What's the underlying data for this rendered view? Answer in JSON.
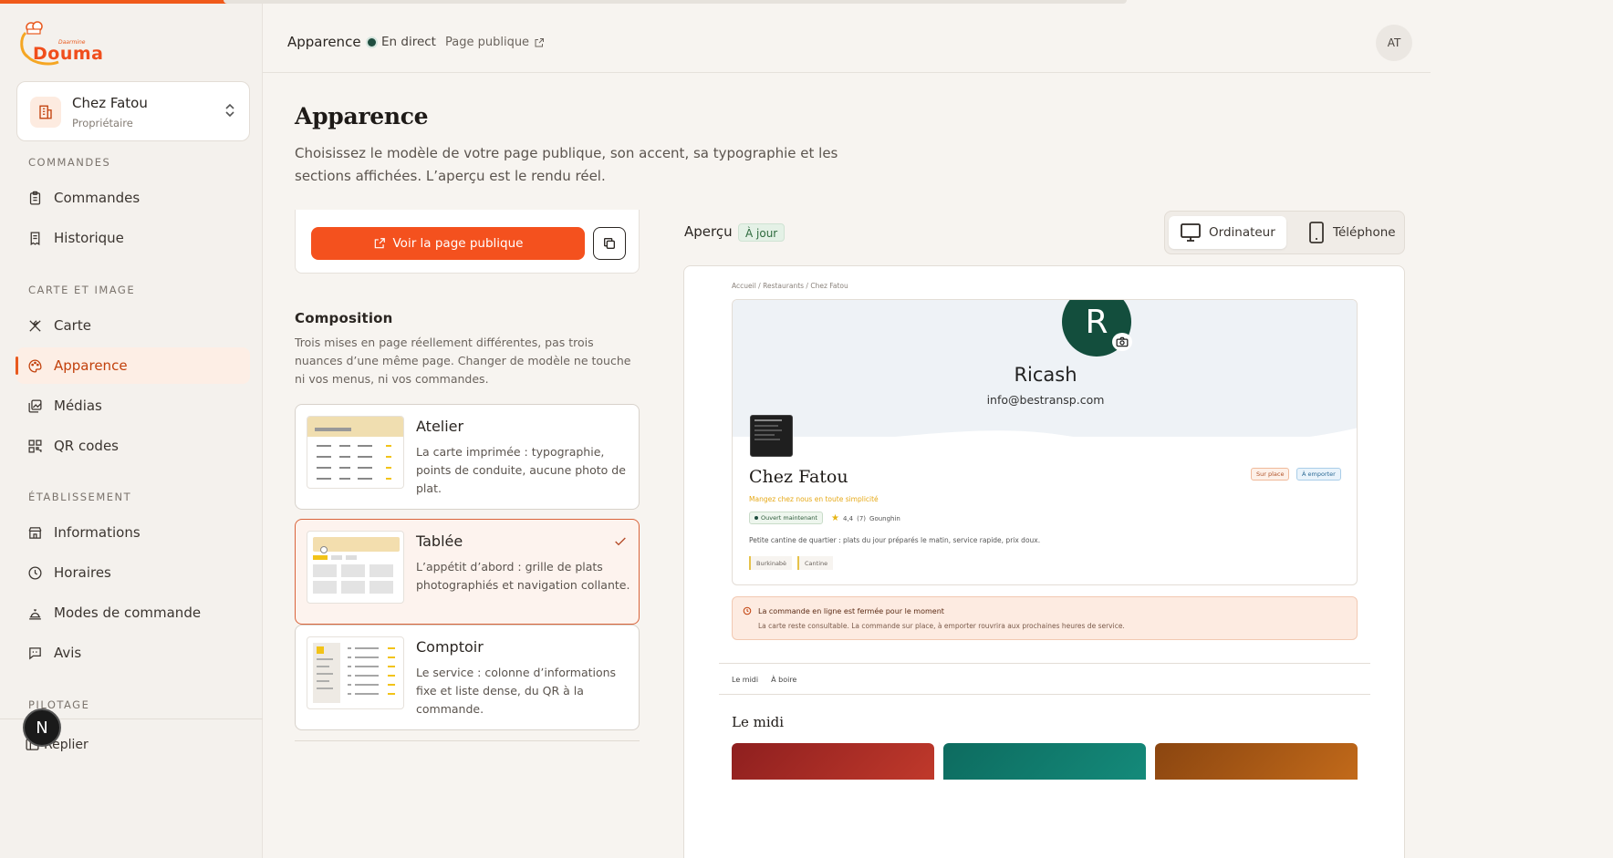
{
  "brand": {
    "logo_text": "Douma",
    "logo_small": "Daarmine"
  },
  "org": {
    "name": "Chez Fatou",
    "role": "Propriétaire"
  },
  "sidebar": {
    "sections": [
      {
        "label": "COMMANDES"
      },
      {
        "label": "CARTE ET IMAGE"
      },
      {
        "label": "ÉTABLISSEMENT"
      },
      {
        "label": "PILOTAGE"
      }
    ],
    "items": [
      {
        "label": "Commandes",
        "icon": "clipboard-icon"
      },
      {
        "label": "Historique",
        "icon": "receipt-icon"
      },
      {
        "label": "Carte",
        "icon": "utensils-icon"
      },
      {
        "label": "Apparence",
        "icon": "palette-icon",
        "active": true
      },
      {
        "label": "Médias",
        "icon": "images-icon"
      },
      {
        "label": "QR codes",
        "icon": "qr-code-icon"
      },
      {
        "label": "Informations",
        "icon": "store-icon"
      },
      {
        "label": "Horaires",
        "icon": "clock-icon"
      },
      {
        "label": "Modes de commande",
        "icon": "bell-icon"
      },
      {
        "label": "Avis",
        "icon": "message-quote-icon"
      }
    ],
    "collapse_label": "Replier",
    "badge": "N"
  },
  "header": {
    "title": "Apparence",
    "status": "En direct",
    "public_link": "Page publique",
    "avatar": "AT"
  },
  "main": {
    "title": "Apparence",
    "description": "Choisissez le modèle de votre page publique, son accent, sa typographie et les sections affichées. L’aperçu est le rendu réel.",
    "public_button": "Voir la page publique",
    "composition": {
      "title": "Composition",
      "description": "Trois mises en page réellement différentes, pas trois nuances d’une même page. Changer de modèle ne touche ni vos menus, ni vos commandes.",
      "templates": [
        {
          "name": "Atelier",
          "description": "La carte imprimée : typographie, points de conduite, aucune photo de plat.",
          "selected": false
        },
        {
          "name": "Tablée",
          "description": "L’appétit d’abord : grille de plats photographiés et navigation collante.",
          "selected": true
        },
        {
          "name": "Comptoir",
          "description": "Le service : colonne d’informations fixe et liste dense, du QR à la commande.",
          "selected": false
        }
      ]
    }
  },
  "preview": {
    "label": "Aperçu",
    "badge": "À jour",
    "devices": [
      {
        "label": "Ordinateur",
        "active": true
      },
      {
        "label": "Téléphone",
        "active": false
      }
    ],
    "breadcrumb": "Accueil  /  Restaurants  /  Chez Fatou",
    "banner_initial": "R",
    "banner_name": "Ricash",
    "banner_email": "info@bestransp.com",
    "restaurant_name": "Chez Fatou",
    "tagline": "Mangez chez nous en toute simplicité",
    "open_status": "Ouvert maintenant",
    "rating": "4,4",
    "rating_count": "(7)",
    "location": "Gounghin",
    "description": "Petite cantine de quartier : plats du jour préparés le matin, service rapide, prix doux.",
    "tags": [
      "Burkinabè",
      "Cantine"
    ],
    "modes": [
      "Sur place",
      "À emporter"
    ],
    "alert_title": "La commande en ligne est fermée pour le moment",
    "alert_text": "La carte reste consultable. La commande sur place, à emporter rouvrira aux prochaines heures de service.",
    "tabs": [
      "Le midi",
      "À boire"
    ],
    "section_title": "Le midi"
  },
  "colors": {
    "accent": "#f4511e",
    "active_bg": "#fdeee5",
    "live": "#1f4d3f"
  }
}
